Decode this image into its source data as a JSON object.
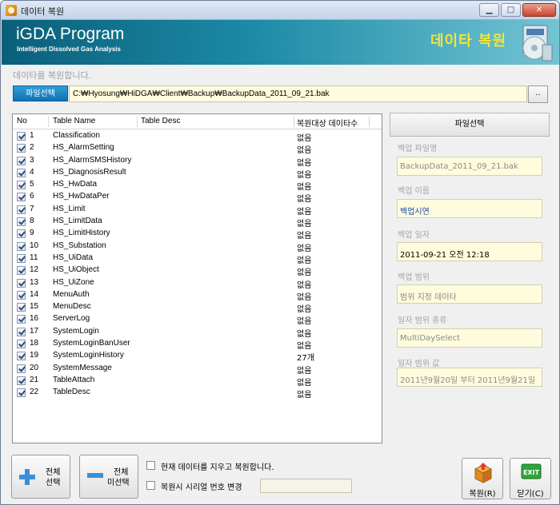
{
  "window": {
    "title": "데이터 복원"
  },
  "banner": {
    "brand": "iGDA Program",
    "subtitle": "Intelligent Dissolved Gas Analysis",
    "heading": "데이타 복원"
  },
  "hint": "데이타를 복원합니다.",
  "file": {
    "button_label": "파일선택",
    "path": "C:₩Hyosung₩HiDGA₩Client₩Backup₩BackupData_2011_09_21.bak",
    "browse_label": ".."
  },
  "table": {
    "columns": [
      "No",
      "Table Name",
      "Table Desc",
      "복원대상 데이타수"
    ],
    "rows": [
      {
        "no": "1",
        "name": "Classification",
        "count": "없음"
      },
      {
        "no": "2",
        "name": "HS_AlarmSetting",
        "count": "없음"
      },
      {
        "no": "3",
        "name": "HS_AlarmSMSHistory",
        "count": "없음"
      },
      {
        "no": "4",
        "name": "HS_DiagnosisResult",
        "count": "없음"
      },
      {
        "no": "5",
        "name": "HS_HwData",
        "count": "없음"
      },
      {
        "no": "6",
        "name": "HS_HwDataPer",
        "count": "없음"
      },
      {
        "no": "7",
        "name": "HS_Limit",
        "count": "없음"
      },
      {
        "no": "8",
        "name": "HS_LimitData",
        "count": "없음"
      },
      {
        "no": "9",
        "name": "HS_LimitHistory",
        "count": "없음"
      },
      {
        "no": "10",
        "name": "HS_Substation",
        "count": "없음"
      },
      {
        "no": "11",
        "name": "HS_UiData",
        "count": "없음"
      },
      {
        "no": "12",
        "name": "HS_UiObject",
        "count": "없음"
      },
      {
        "no": "13",
        "name": "HS_UiZone",
        "count": "없음"
      },
      {
        "no": "14",
        "name": "MenuAuth",
        "count": "없음"
      },
      {
        "no": "15",
        "name": "MenuDesc",
        "count": "없음"
      },
      {
        "no": "16",
        "name": "ServerLog",
        "count": "없음"
      },
      {
        "no": "17",
        "name": "SystemLogin",
        "count": "없음"
      },
      {
        "no": "18",
        "name": "SystemLoginBanUser",
        "count": "없음"
      },
      {
        "no": "19",
        "name": "SystemLoginHistory",
        "count": "27개"
      },
      {
        "no": "20",
        "name": "SystemMessage",
        "count": "없음"
      },
      {
        "no": "21",
        "name": "TableAttach",
        "count": "없음"
      },
      {
        "no": "22",
        "name": "TableDesc",
        "count": "없음"
      }
    ]
  },
  "info": {
    "button_label": "파일선택",
    "fields": [
      {
        "label": "백업 파일명",
        "value": "BackupData_2011_09_21.bak",
        "style": "grey"
      },
      {
        "label": "백업 이름",
        "value": "백업시연",
        "style": "blue"
      },
      {
        "label": "백업 일자",
        "value": "2011-09-21 오전 12:18",
        "style": ""
      },
      {
        "label": "백업 범위",
        "value": "범위 지정 데이타",
        "style": "grey"
      },
      {
        "label": "일자 범위 종류",
        "value": "MultiDaySelect",
        "style": "grey"
      },
      {
        "label": "일자 범위 값",
        "value": "2011년9월20일 부터 2011년9월21일",
        "style": "grey"
      }
    ]
  },
  "bottom": {
    "select_all": [
      "전체",
      "선택"
    ],
    "deselect_all": [
      "전체",
      "미선택"
    ],
    "option_clear": "현재 데이터를 지우고 복원합니다.",
    "option_serial": "복원시 시리얼 번호 변경",
    "restore_label": "복원(R)",
    "close_label": "닫기(C)",
    "exit_icon_text": "EXIT"
  },
  "colors": {
    "banner_start": "#0a5f7a",
    "banner_end": "#73c4d3",
    "heading": "#f3e635",
    "field_bg": "#fffbdd",
    "accent_button": "#1171b6"
  }
}
